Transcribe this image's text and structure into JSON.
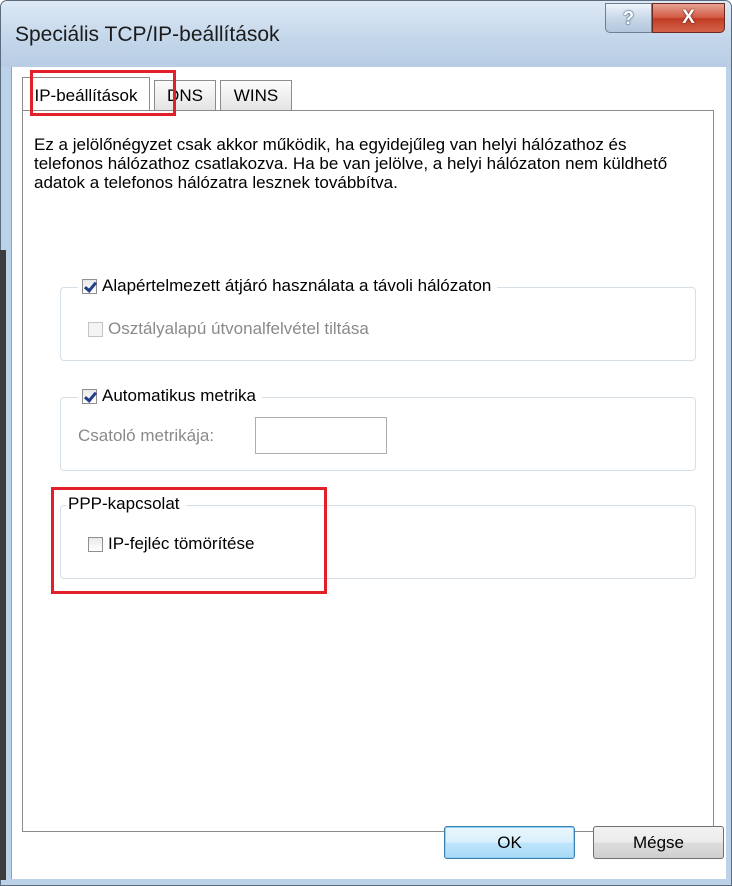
{
  "window": {
    "title": "Speciális TCP/IP-beállítások",
    "help_label": "?",
    "close_label": "X"
  },
  "tabs": [
    {
      "label": "IP-beállítások",
      "active": true
    },
    {
      "label": "DNS",
      "active": false
    },
    {
      "label": "WINS",
      "active": false
    }
  ],
  "description": "Ez a jelölőnégyzet csak akkor működik, ha egyidejűleg van helyi hálózathoz és telefonos hálózathoz csatlakozva. Ha be van jelölve, a helyi hálózaton nem küldhető adatok a telefonos hálózatra lesznek továbbítva.",
  "gateway_group": {
    "checkbox_label": "Alapértelmezett átjáró használata a távoli hálózaton",
    "checked": true,
    "sub_checkbox_label": "Osztályalapú útvonalfelvétel tiltása",
    "sub_checked": false,
    "sub_enabled": false
  },
  "metric_group": {
    "checkbox_label": "Automatikus metrika",
    "checked": true,
    "field_label": "Csatoló metrikája:",
    "field_value": ""
  },
  "ppp_group": {
    "legend": "PPP-kapcsolat",
    "checkbox_label": "IP-fejléc tömörítése",
    "checked": false
  },
  "buttons": {
    "ok_label": "OK",
    "cancel_label": "Mégse"
  },
  "colors": {
    "highlight": "#e2202a",
    "check_mark": "#233f8a"
  }
}
